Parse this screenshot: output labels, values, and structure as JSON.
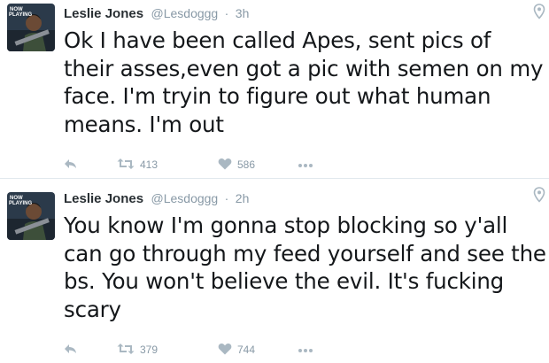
{
  "tweets": [
    {
      "name": "Leslie Jones",
      "handle": "@Lesdoggg",
      "separator": "·",
      "time": "3h",
      "text": "Ok I have been called Apes, sent pics of their asses,even got a pic with semen on my face. I'm tryin to figure out what human means. I'm out",
      "retweets": "413",
      "likes": "586",
      "avatar_badge": [
        "NOW",
        "PLAYING"
      ]
    },
    {
      "name": "Leslie Jones",
      "handle": "@Lesdoggg",
      "separator": "·",
      "time": "2h",
      "text": "You know I'm gonna stop blocking so y'all can go through my feed yourself and see the bs. You won't believe the evil. It's fucking scary",
      "retweets": "379",
      "likes": "744",
      "avatar_badge": [
        "NOW",
        "PLAYING"
      ]
    }
  ],
  "colors": {
    "text": "#14171a",
    "secondary": "#8899a6",
    "icon": "#aab8c2",
    "divider": "#e1e8ed"
  },
  "icons": [
    "reply-icon",
    "retweet-icon",
    "like-icon",
    "more-icon",
    "location-pin-icon"
  ]
}
